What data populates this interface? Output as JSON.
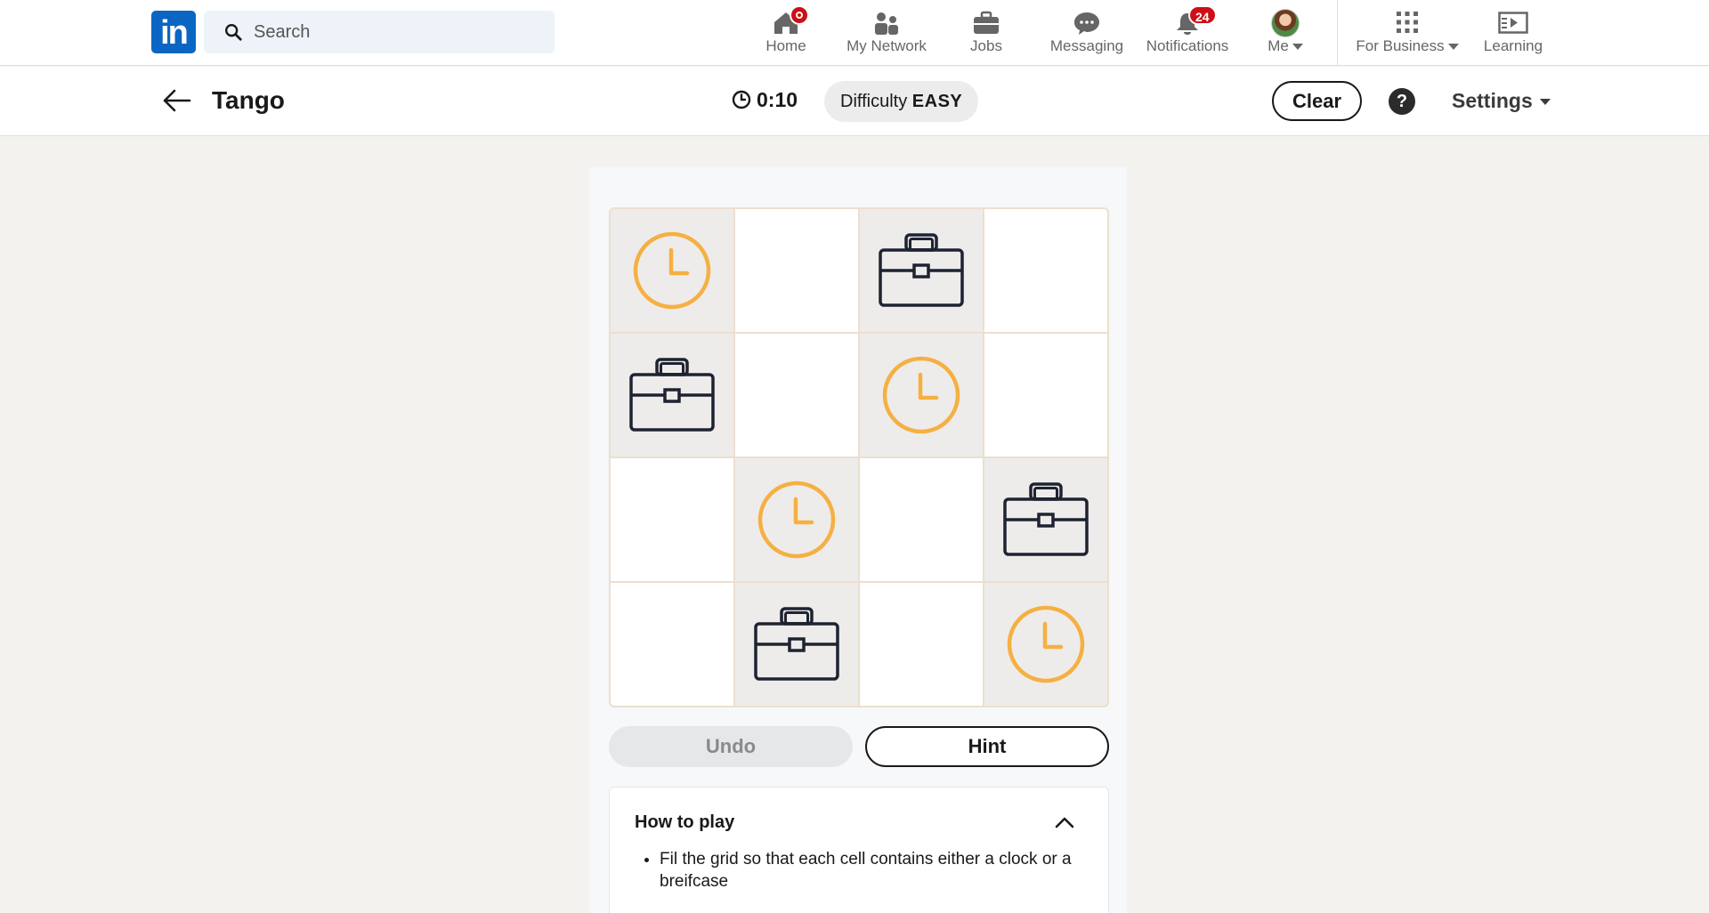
{
  "nav": {
    "search_placeholder": "Search",
    "items": [
      {
        "label": "Home",
        "icon": "home-icon"
      },
      {
        "label": "My Network",
        "icon": "network-icon"
      },
      {
        "label": "Jobs",
        "icon": "briefcase-icon"
      },
      {
        "label": "Messaging",
        "icon": "messaging-icon"
      },
      {
        "label": "Notifications",
        "icon": "bell-icon",
        "badge": "24"
      },
      {
        "label": "Me",
        "icon": "avatar"
      },
      {
        "label": "For Business",
        "icon": "grid-icon"
      },
      {
        "label": "Learning",
        "icon": "learning-icon"
      }
    ]
  },
  "game": {
    "title": "Tango",
    "timer": "0:10",
    "difficulty_prefix": "Difficulty",
    "difficulty_level": "EASY",
    "clear_label": "Clear",
    "help_label": "?",
    "settings_label": "Settings",
    "board": [
      [
        {
          "v": "clock",
          "locked": true
        },
        {
          "v": "",
          "locked": false
        },
        {
          "v": "briefcase",
          "locked": true
        },
        {
          "v": "",
          "locked": false
        }
      ],
      [
        {
          "v": "briefcase",
          "locked": true
        },
        {
          "v": "",
          "locked": false
        },
        {
          "v": "clock",
          "locked": true
        },
        {
          "v": "",
          "locked": false
        }
      ],
      [
        {
          "v": "",
          "locked": false
        },
        {
          "v": "clock",
          "locked": true
        },
        {
          "v": "",
          "locked": false
        },
        {
          "v": "briefcase",
          "locked": true
        }
      ],
      [
        {
          "v": "",
          "locked": false
        },
        {
          "v": "briefcase",
          "locked": true
        },
        {
          "v": "",
          "locked": false
        },
        {
          "v": "clock",
          "locked": true
        }
      ]
    ],
    "undo_label": "Undo",
    "hint_label": "Hint",
    "howto_title": "How to play",
    "howto_rules": [
      "Fil the grid so that each cell contains either a clock or a breifcase"
    ]
  },
  "colors": {
    "brand": "#0a66c2",
    "clock": "#f5b043",
    "briefcase": "#1d2331",
    "badge": "#cc1016"
  }
}
